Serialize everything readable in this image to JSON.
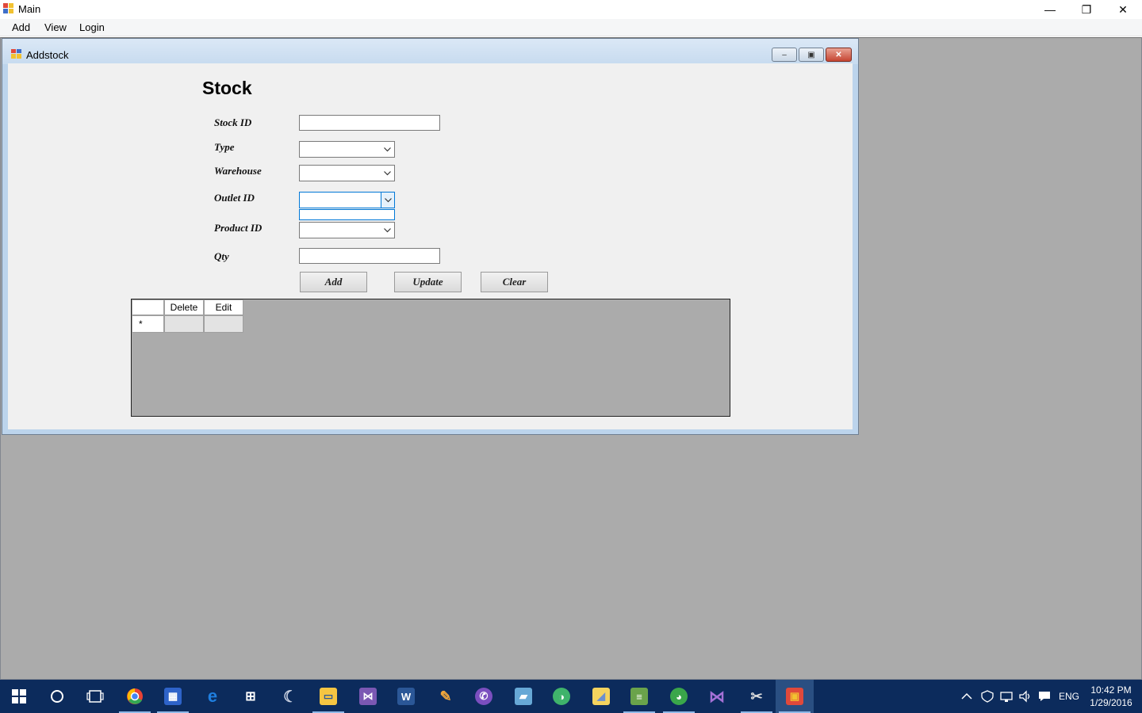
{
  "window": {
    "title": "Main",
    "minimize_glyph": "—",
    "maximize_glyph": "❐",
    "close_glyph": "✕"
  },
  "menu": {
    "items": [
      "Add",
      "View",
      "Login"
    ]
  },
  "child": {
    "title": "Addstock",
    "minimize_glyph": "–",
    "maximize_glyph": "▣",
    "close_glyph": "✕"
  },
  "form": {
    "heading": "Stock",
    "labels": {
      "stock_id": "Stock ID",
      "type": "Type",
      "warehouse": "Warehouse",
      "outlet_id": "Outlet ID",
      "product_id": "Product ID",
      "qty": "Qty"
    },
    "values": {
      "stock_id": "",
      "type": "",
      "warehouse": "",
      "outlet_id": "",
      "product_id": "",
      "qty": ""
    },
    "buttons": {
      "add": "Add",
      "update": "Update",
      "clear": "Clear"
    }
  },
  "grid": {
    "columns": [
      "",
      "Delete",
      "Edit"
    ],
    "new_row_marker": "*"
  },
  "taskbar": {
    "icons": [
      "windows-start-icon",
      "cortana-search-icon",
      "task-view-icon",
      "chrome-icon",
      "calculator-icon",
      "edge-icon",
      "store-icon",
      "eclipse-icon",
      "file-explorer-icon",
      "visual-studio-icon",
      "word-icon",
      "tool-icon",
      "viber-icon",
      "notes-icon",
      "browser-icon",
      "folder-icon",
      "books-icon",
      "color-icon",
      "visual-studio-2-icon",
      "settings-tool-icon",
      "main-app-icon"
    ],
    "colors": {
      "chrome": "#e94235",
      "calculator": "#2e63c9",
      "edge": "#1f7fe0",
      "store": "#ffffff",
      "eclipse": "#4b6fae",
      "explorer": "#f5c542",
      "vs": "#7b58b3",
      "word": "#2b5797",
      "tool": "#f0a63c",
      "viber": "#7b4fbf",
      "notes": "#67a8d6",
      "browser": "#3fb36b",
      "folder": "#f4d35e",
      "books": "#6aa34b",
      "color": "#3aa64a",
      "vs2": "#a571d6",
      "settings": "#dddddd",
      "app": "#e0493b"
    },
    "tray": {
      "language": "ENG",
      "time": "10:42 PM",
      "date": "1/29/2016"
    }
  }
}
